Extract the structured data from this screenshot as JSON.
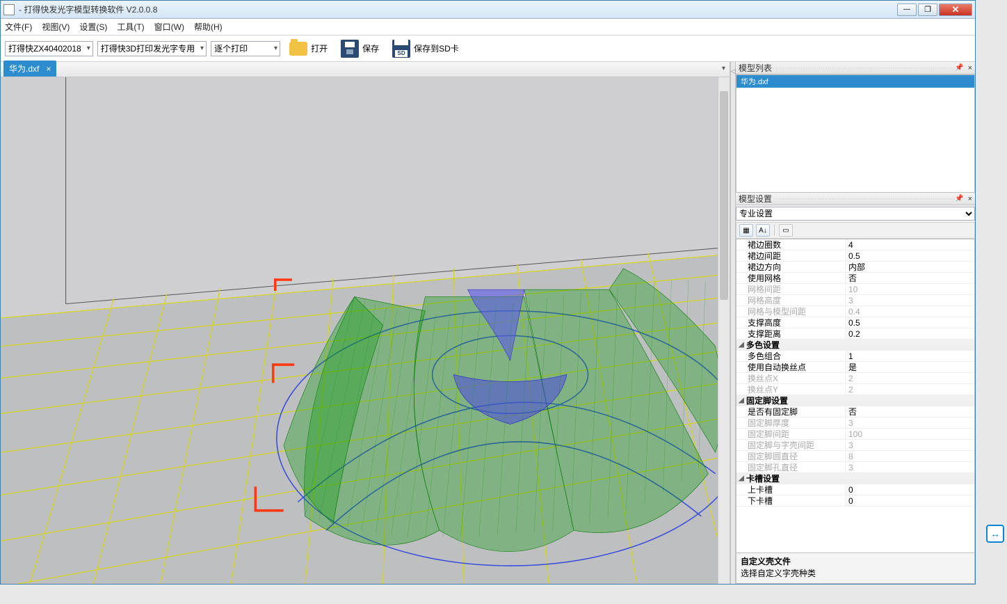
{
  "title": " - 打得快发光字模型转换软件 V2.0.0.8",
  "menu": [
    "文件(F)",
    "视图(V)",
    "设置(S)",
    "工具(T)",
    "窗口(W)",
    "帮助(H)"
  ],
  "toolbar": {
    "printer": "打得快ZX40402018",
    "profile": "打得快3D打印发光字专用",
    "mode": "逐个打印",
    "open": "打开",
    "save": "保存",
    "saveSd": "保存到SD卡"
  },
  "tab": {
    "name": "华为.dxf"
  },
  "panels": {
    "modelList": {
      "title": "模型列表",
      "items": [
        "华为.dxf"
      ]
    },
    "modelSettings": {
      "title": "模型设置",
      "dropdown": "专业设置",
      "groups": [
        {
          "type": "row",
          "key": "裙边圈数",
          "val": "4"
        },
        {
          "type": "row",
          "key": "裙边间距",
          "val": "0.5"
        },
        {
          "type": "row",
          "key": "裙边方向",
          "val": "内部"
        },
        {
          "type": "row",
          "key": "使用网格",
          "val": "否"
        },
        {
          "type": "row",
          "key": "网格间距",
          "val": "10",
          "disabled": true
        },
        {
          "type": "row",
          "key": "网格高度",
          "val": "3",
          "disabled": true
        },
        {
          "type": "row",
          "key": "网格与模型间距",
          "val": "0.4",
          "disabled": true
        },
        {
          "type": "row",
          "key": "支撑高度",
          "val": "0.5"
        },
        {
          "type": "row",
          "key": "支撑距离",
          "val": "0.2"
        },
        {
          "type": "group",
          "key": "多色设置"
        },
        {
          "type": "row",
          "key": "多色组合",
          "val": "1"
        },
        {
          "type": "row",
          "key": "使用自动换丝点",
          "val": "是"
        },
        {
          "type": "row",
          "key": "换丝点X",
          "val": "2",
          "disabled": true
        },
        {
          "type": "row",
          "key": "换丝点Y",
          "val": "2",
          "disabled": true
        },
        {
          "type": "group",
          "key": "固定脚设置"
        },
        {
          "type": "row",
          "key": "是否有固定脚",
          "val": "否"
        },
        {
          "type": "row",
          "key": "固定脚厚度",
          "val": "3",
          "disabled": true
        },
        {
          "type": "row",
          "key": "固定脚间距",
          "val": "100",
          "disabled": true
        },
        {
          "type": "row",
          "key": "固定脚与字壳间距",
          "val": "3",
          "disabled": true
        },
        {
          "type": "row",
          "key": "固定脚圆直径",
          "val": "8",
          "disabled": true
        },
        {
          "type": "row",
          "key": "固定脚孔直径",
          "val": "3",
          "disabled": true
        },
        {
          "type": "group",
          "key": "卡槽设置"
        },
        {
          "type": "row",
          "key": "上卡槽",
          "val": "0"
        },
        {
          "type": "row",
          "key": "下卡槽",
          "val": "0"
        }
      ],
      "descTitle": "自定义壳文件",
      "descBody": "选择自定义字壳种类"
    }
  }
}
